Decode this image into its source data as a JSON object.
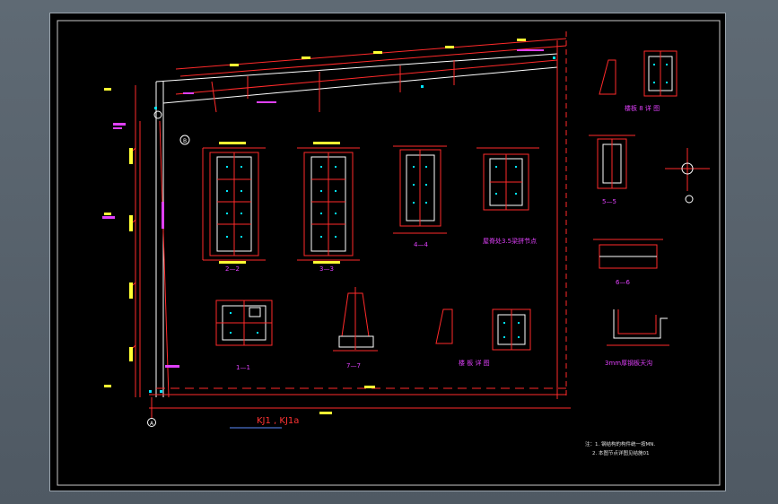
{
  "drawing": {
    "frame_caption": "KJ1 , KJ1a",
    "notes_line1": "注：1. 钢结构的构件统一按MN.",
    "notes_line2": "2. 本图节点详图见结施01",
    "sections": {
      "s2": "2—2",
      "s3": "3—3",
      "s4": "4—4",
      "s1": "1—1",
      "s7": "7—7",
      "s5": "5—5",
      "s6": "6—6"
    },
    "labels": {
      "eave_joint": "屋脊处3.5梁拼节点",
      "stiffener_top": "楼板 8 详 图",
      "stiffener_mid": "楼 板 详 图",
      "gutter": "3mm厚钢板天沟"
    },
    "axis_bubbles": {
      "left_bottom": "A",
      "right_mid": "B"
    },
    "colors": {
      "background": "#000000",
      "member_line": "#ff2a2a",
      "frame_line": "#ffffff",
      "dimension_text": "#ffff33",
      "label_text": "#e040fb",
      "annotation_text": "#ff3333",
      "bolt_marks": "#00e5ff"
    }
  }
}
